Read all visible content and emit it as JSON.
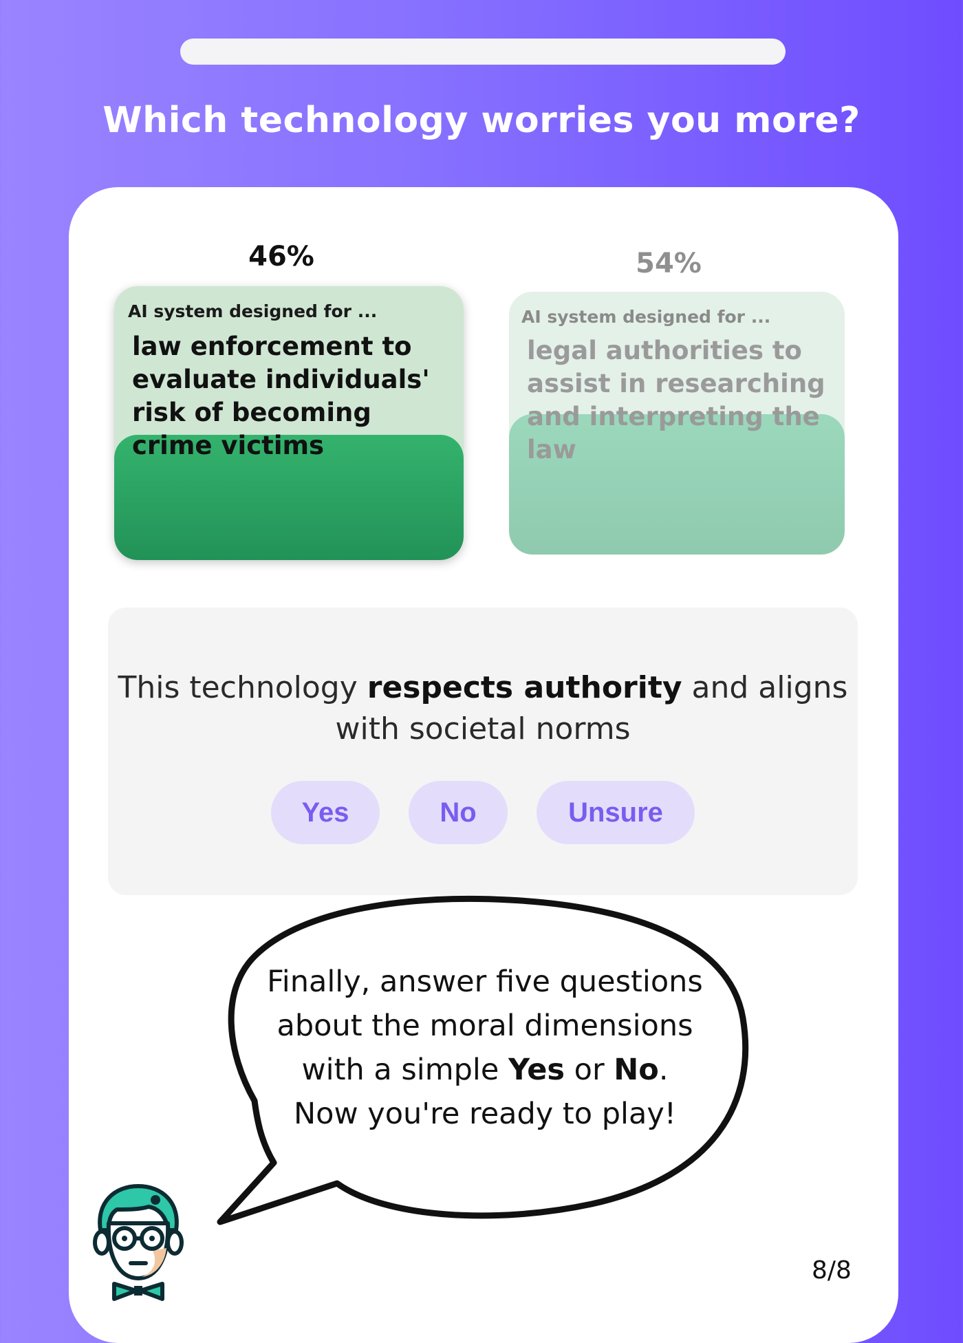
{
  "progress": {
    "value": 1.0
  },
  "question": "Which technology worries you more?",
  "options": [
    {
      "percent": "46%",
      "kicker": "AI system designed for ...",
      "text": "law enforcement to evaluate individuals' risk of becoming crime victims",
      "state": "selected"
    },
    {
      "percent": "54%",
      "kicker": "AI system designed for ...",
      "text": "legal authorities to assist in researching and interpreting the law",
      "state": "unselected"
    }
  ],
  "dimension": {
    "prefix": "This technology ",
    "emphasis": "respects authority",
    "suffix": " and aligns with societal norms"
  },
  "answers": {
    "yes": "Yes",
    "no": "No",
    "unsure": "Unsure"
  },
  "bubble": {
    "line1": "Finally, answer five questions",
    "line2": "about the moral dimensions",
    "line3_prefix": "with a simple ",
    "yes": "Yes",
    "or": " or ",
    "no": "No",
    "line3_suffix": ".",
    "line4": "Now you're ready to play!"
  },
  "page_counter": "8/8",
  "colors": {
    "background": "#8670ff",
    "selected_fill": "#2ea362",
    "unselected_fill": "#95d2b6",
    "answer_button": "#e3ddfb",
    "answer_text": "#7a5cf0"
  }
}
